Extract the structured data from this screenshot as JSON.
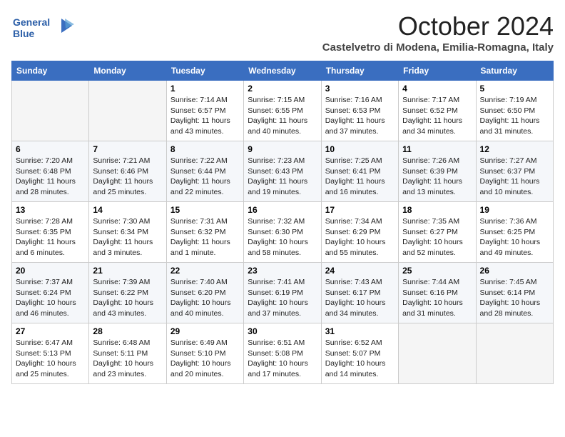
{
  "header": {
    "logo_text_general": "General",
    "logo_text_blue": "Blue",
    "month_title": "October 2024",
    "location": "Castelvetro di Modena, Emilia-Romagna, Italy"
  },
  "weekdays": [
    "Sunday",
    "Monday",
    "Tuesday",
    "Wednesday",
    "Thursday",
    "Friday",
    "Saturday"
  ],
  "weeks": [
    [
      {
        "day": "",
        "detail": ""
      },
      {
        "day": "",
        "detail": ""
      },
      {
        "day": "1",
        "detail": "Sunrise: 7:14 AM\nSunset: 6:57 PM\nDaylight: 11 hours and 43 minutes."
      },
      {
        "day": "2",
        "detail": "Sunrise: 7:15 AM\nSunset: 6:55 PM\nDaylight: 11 hours and 40 minutes."
      },
      {
        "day": "3",
        "detail": "Sunrise: 7:16 AM\nSunset: 6:53 PM\nDaylight: 11 hours and 37 minutes."
      },
      {
        "day": "4",
        "detail": "Sunrise: 7:17 AM\nSunset: 6:52 PM\nDaylight: 11 hours and 34 minutes."
      },
      {
        "day": "5",
        "detail": "Sunrise: 7:19 AM\nSunset: 6:50 PM\nDaylight: 11 hours and 31 minutes."
      }
    ],
    [
      {
        "day": "6",
        "detail": "Sunrise: 7:20 AM\nSunset: 6:48 PM\nDaylight: 11 hours and 28 minutes."
      },
      {
        "day": "7",
        "detail": "Sunrise: 7:21 AM\nSunset: 6:46 PM\nDaylight: 11 hours and 25 minutes."
      },
      {
        "day": "8",
        "detail": "Sunrise: 7:22 AM\nSunset: 6:44 PM\nDaylight: 11 hours and 22 minutes."
      },
      {
        "day": "9",
        "detail": "Sunrise: 7:23 AM\nSunset: 6:43 PM\nDaylight: 11 hours and 19 minutes."
      },
      {
        "day": "10",
        "detail": "Sunrise: 7:25 AM\nSunset: 6:41 PM\nDaylight: 11 hours and 16 minutes."
      },
      {
        "day": "11",
        "detail": "Sunrise: 7:26 AM\nSunset: 6:39 PM\nDaylight: 11 hours and 13 minutes."
      },
      {
        "day": "12",
        "detail": "Sunrise: 7:27 AM\nSunset: 6:37 PM\nDaylight: 11 hours and 10 minutes."
      }
    ],
    [
      {
        "day": "13",
        "detail": "Sunrise: 7:28 AM\nSunset: 6:35 PM\nDaylight: 11 hours and 6 minutes."
      },
      {
        "day": "14",
        "detail": "Sunrise: 7:30 AM\nSunset: 6:34 PM\nDaylight: 11 hours and 3 minutes."
      },
      {
        "day": "15",
        "detail": "Sunrise: 7:31 AM\nSunset: 6:32 PM\nDaylight: 11 hours and 1 minute."
      },
      {
        "day": "16",
        "detail": "Sunrise: 7:32 AM\nSunset: 6:30 PM\nDaylight: 10 hours and 58 minutes."
      },
      {
        "day": "17",
        "detail": "Sunrise: 7:34 AM\nSunset: 6:29 PM\nDaylight: 10 hours and 55 minutes."
      },
      {
        "day": "18",
        "detail": "Sunrise: 7:35 AM\nSunset: 6:27 PM\nDaylight: 10 hours and 52 minutes."
      },
      {
        "day": "19",
        "detail": "Sunrise: 7:36 AM\nSunset: 6:25 PM\nDaylight: 10 hours and 49 minutes."
      }
    ],
    [
      {
        "day": "20",
        "detail": "Sunrise: 7:37 AM\nSunset: 6:24 PM\nDaylight: 10 hours and 46 minutes."
      },
      {
        "day": "21",
        "detail": "Sunrise: 7:39 AM\nSunset: 6:22 PM\nDaylight: 10 hours and 43 minutes."
      },
      {
        "day": "22",
        "detail": "Sunrise: 7:40 AM\nSunset: 6:20 PM\nDaylight: 10 hours and 40 minutes."
      },
      {
        "day": "23",
        "detail": "Sunrise: 7:41 AM\nSunset: 6:19 PM\nDaylight: 10 hours and 37 minutes."
      },
      {
        "day": "24",
        "detail": "Sunrise: 7:43 AM\nSunset: 6:17 PM\nDaylight: 10 hours and 34 minutes."
      },
      {
        "day": "25",
        "detail": "Sunrise: 7:44 AM\nSunset: 6:16 PM\nDaylight: 10 hours and 31 minutes."
      },
      {
        "day": "26",
        "detail": "Sunrise: 7:45 AM\nSunset: 6:14 PM\nDaylight: 10 hours and 28 minutes."
      }
    ],
    [
      {
        "day": "27",
        "detail": "Sunrise: 6:47 AM\nSunset: 5:13 PM\nDaylight: 10 hours and 25 minutes."
      },
      {
        "day": "28",
        "detail": "Sunrise: 6:48 AM\nSunset: 5:11 PM\nDaylight: 10 hours and 23 minutes."
      },
      {
        "day": "29",
        "detail": "Sunrise: 6:49 AM\nSunset: 5:10 PM\nDaylight: 10 hours and 20 minutes."
      },
      {
        "day": "30",
        "detail": "Sunrise: 6:51 AM\nSunset: 5:08 PM\nDaylight: 10 hours and 17 minutes."
      },
      {
        "day": "31",
        "detail": "Sunrise: 6:52 AM\nSunset: 5:07 PM\nDaylight: 10 hours and 14 minutes."
      },
      {
        "day": "",
        "detail": ""
      },
      {
        "day": "",
        "detail": ""
      }
    ]
  ]
}
